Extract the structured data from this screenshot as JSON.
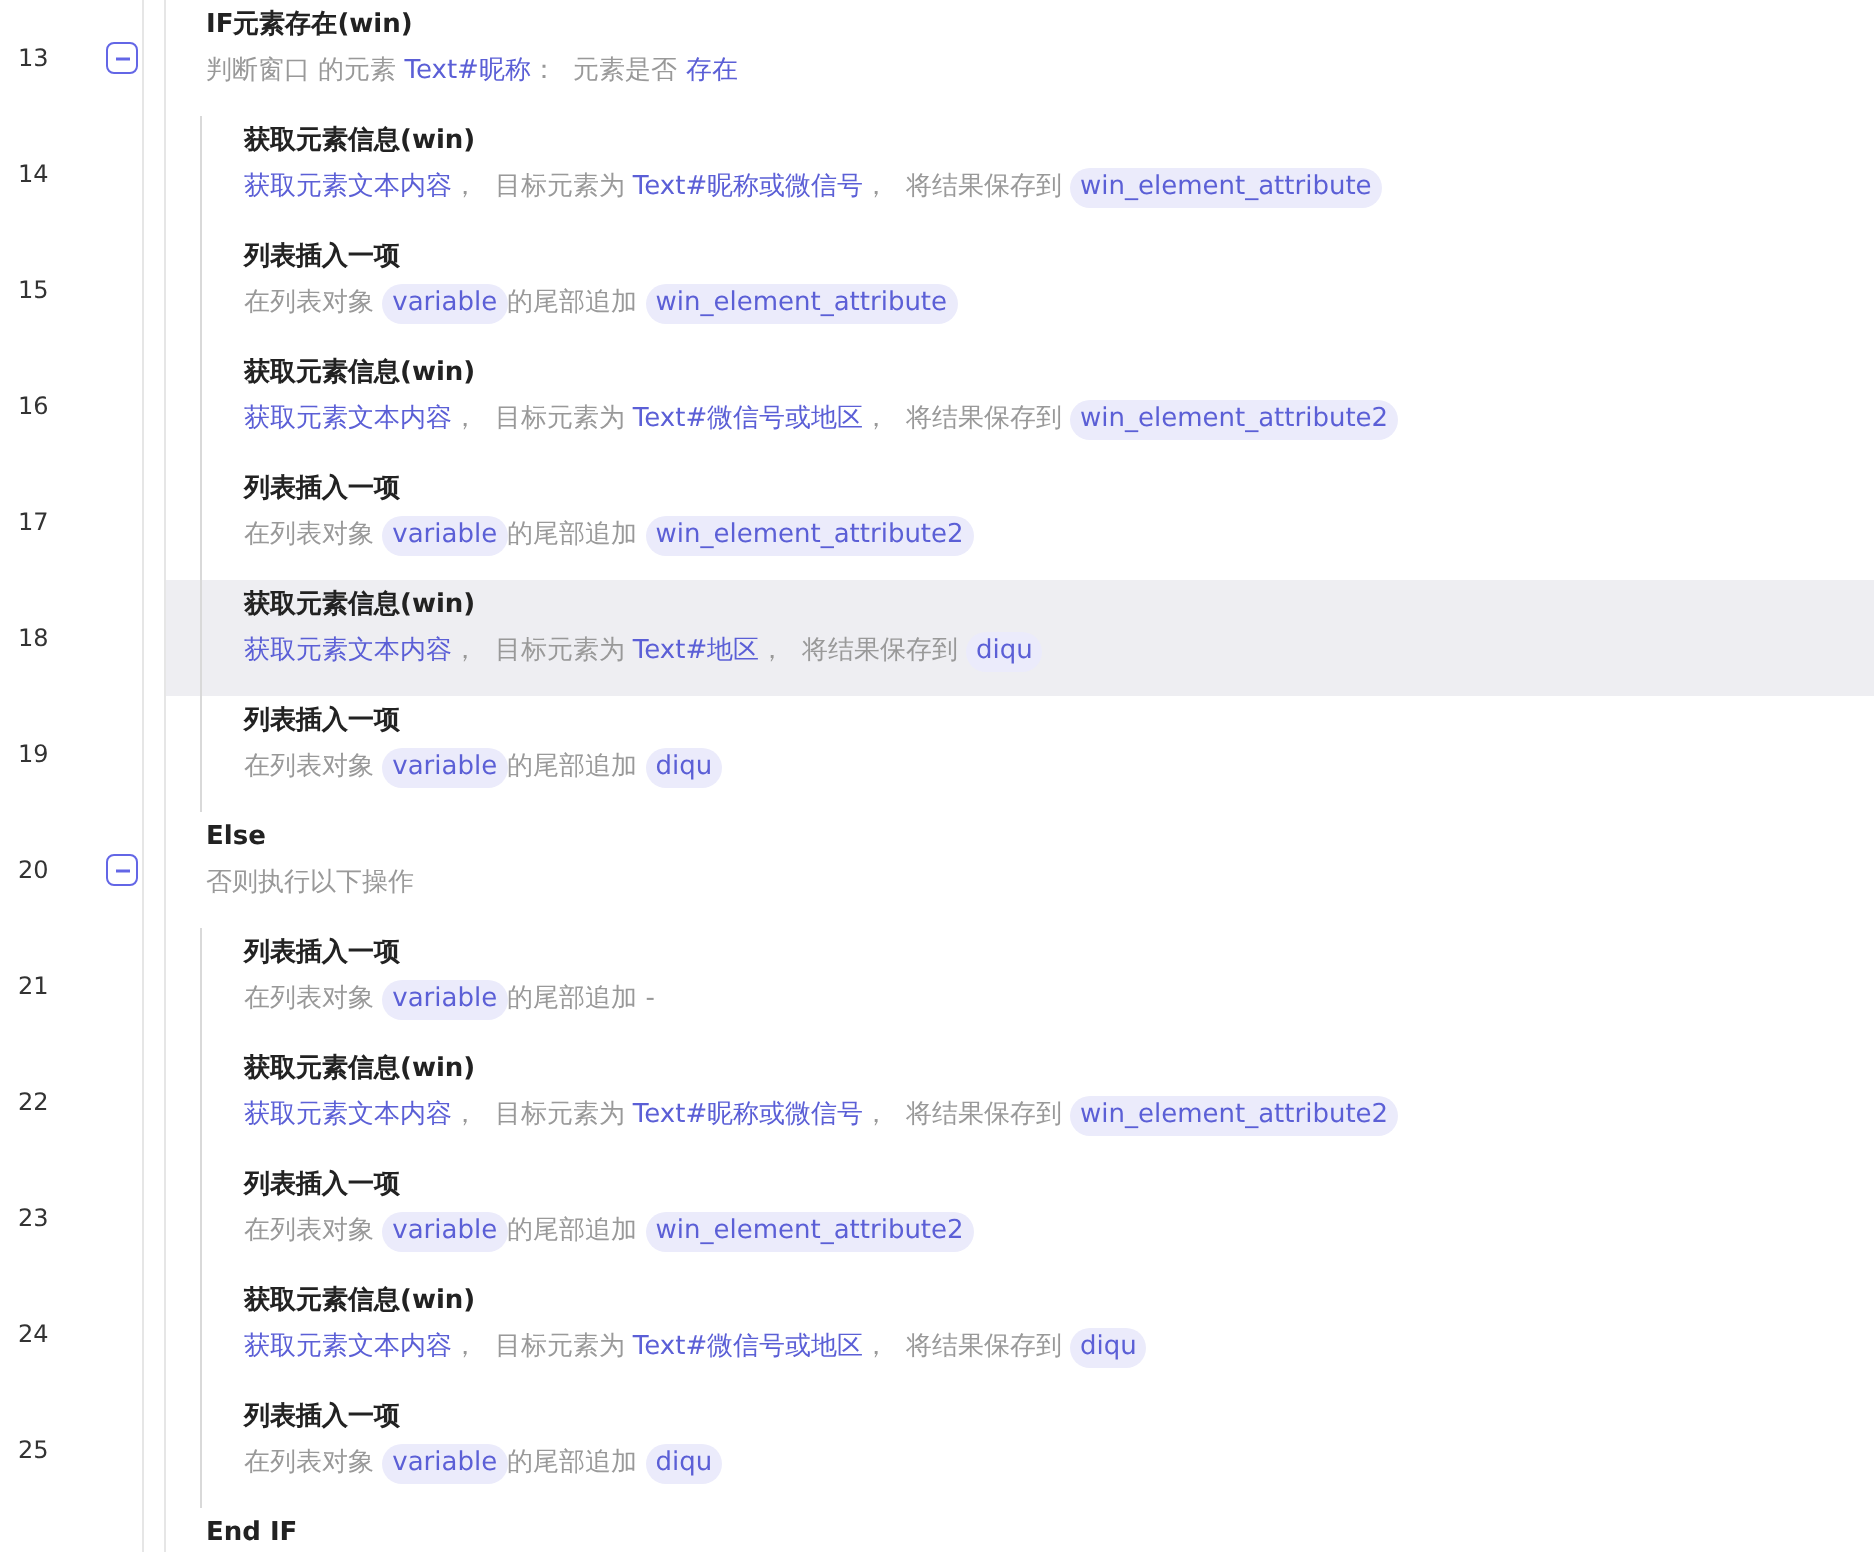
{
  "rows": [
    {
      "number": "13",
      "title": "IF元素存在(win)",
      "expanded": true,
      "selected": false,
      "desc": [
        {
          "kind": "plain",
          "text": "判断窗口 的元素 "
        },
        {
          "kind": "link",
          "text": "Text#昵称"
        },
        {
          "kind": "plain",
          "text": "：  元素是否 "
        },
        {
          "kind": "link",
          "text": "存在"
        }
      ],
      "children": [
        {
          "number": "14",
          "title": "获取元素信息(win)",
          "selected": false,
          "desc": [
            {
              "kind": "link",
              "text": "获取元素文本内容"
            },
            {
              "kind": "plain",
              "text": "，  目标元素为 "
            },
            {
              "kind": "link",
              "text": "Text#昵称或微信号"
            },
            {
              "kind": "plain",
              "text": "，  将结果保存到 "
            },
            {
              "kind": "var",
              "text": "win_element_attribute"
            }
          ]
        },
        {
          "number": "15",
          "title": "列表插入一项",
          "selected": false,
          "desc": [
            {
              "kind": "plain",
              "text": "在列表对象 "
            },
            {
              "kind": "var",
              "text": "variable"
            },
            {
              "kind": "plain",
              "text": "的尾部追加 "
            },
            {
              "kind": "var",
              "text": "win_element_attribute"
            }
          ]
        },
        {
          "number": "16",
          "title": "获取元素信息(win)",
          "selected": false,
          "desc": [
            {
              "kind": "link",
              "text": "获取元素文本内容"
            },
            {
              "kind": "plain",
              "text": "，  目标元素为 "
            },
            {
              "kind": "link",
              "text": "Text#微信号或地区"
            },
            {
              "kind": "plain",
              "text": "，  将结果保存到 "
            },
            {
              "kind": "var",
              "text": "win_element_attribute2"
            }
          ]
        },
        {
          "number": "17",
          "title": "列表插入一项",
          "selected": false,
          "desc": [
            {
              "kind": "plain",
              "text": "在列表对象 "
            },
            {
              "kind": "var",
              "text": "variable"
            },
            {
              "kind": "plain",
              "text": "的尾部追加 "
            },
            {
              "kind": "var",
              "text": "win_element_attribute2"
            }
          ]
        },
        {
          "number": "18",
          "title": "获取元素信息(win)",
          "selected": true,
          "desc": [
            {
              "kind": "link",
              "text": "获取元素文本内容"
            },
            {
              "kind": "plain",
              "text": "，  目标元素为 "
            },
            {
              "kind": "link",
              "text": "Text#地区"
            },
            {
              "kind": "plain",
              "text": "，  将结果保存到 "
            },
            {
              "kind": "var",
              "text": "diqu"
            }
          ]
        },
        {
          "number": "19",
          "title": "列表插入一项",
          "selected": false,
          "desc": [
            {
              "kind": "plain",
              "text": "在列表对象 "
            },
            {
              "kind": "var",
              "text": "variable"
            },
            {
              "kind": "plain",
              "text": "的尾部追加 "
            },
            {
              "kind": "var",
              "text": "diqu"
            }
          ]
        }
      ]
    },
    {
      "number": "20",
      "title": "Else",
      "expanded": true,
      "selected": false,
      "desc": [
        {
          "kind": "plain",
          "text": "否则执行以下操作"
        }
      ],
      "children": [
        {
          "number": "21",
          "title": "列表插入一项",
          "selected": false,
          "desc": [
            {
              "kind": "plain",
              "text": "在列表对象 "
            },
            {
              "kind": "var",
              "text": "variable"
            },
            {
              "kind": "plain",
              "text": "的尾部追加 -"
            }
          ]
        },
        {
          "number": "22",
          "title": "获取元素信息(win)",
          "selected": false,
          "desc": [
            {
              "kind": "link",
              "text": "获取元素文本内容"
            },
            {
              "kind": "plain",
              "text": "，  目标元素为 "
            },
            {
              "kind": "link",
              "text": "Text#昵称或微信号"
            },
            {
              "kind": "plain",
              "text": "，  将结果保存到 "
            },
            {
              "kind": "var",
              "text": "win_element_attribute2"
            }
          ]
        },
        {
          "number": "23",
          "title": "列表插入一项",
          "selected": false,
          "desc": [
            {
              "kind": "plain",
              "text": "在列表对象 "
            },
            {
              "kind": "var",
              "text": "variable"
            },
            {
              "kind": "plain",
              "text": "的尾部追加 "
            },
            {
              "kind": "var",
              "text": "win_element_attribute2"
            }
          ]
        },
        {
          "number": "24",
          "title": "获取元素信息(win)",
          "selected": false,
          "desc": [
            {
              "kind": "link",
              "text": "获取元素文本内容"
            },
            {
              "kind": "plain",
              "text": "，  目标元素为 "
            },
            {
              "kind": "link",
              "text": "Text#微信号或地区"
            },
            {
              "kind": "plain",
              "text": "，  将结果保存到 "
            },
            {
              "kind": "var",
              "text": "diqu"
            }
          ]
        },
        {
          "number": "25",
          "title": "列表插入一项",
          "selected": false,
          "desc": [
            {
              "kind": "plain",
              "text": "在列表对象 "
            },
            {
              "kind": "var",
              "text": "variable"
            },
            {
              "kind": "plain",
              "text": "的尾部追加 "
            },
            {
              "kind": "var",
              "text": "diqu"
            }
          ]
        }
      ]
    },
    {
      "title": "End IF",
      "selected": false
    }
  ]
}
